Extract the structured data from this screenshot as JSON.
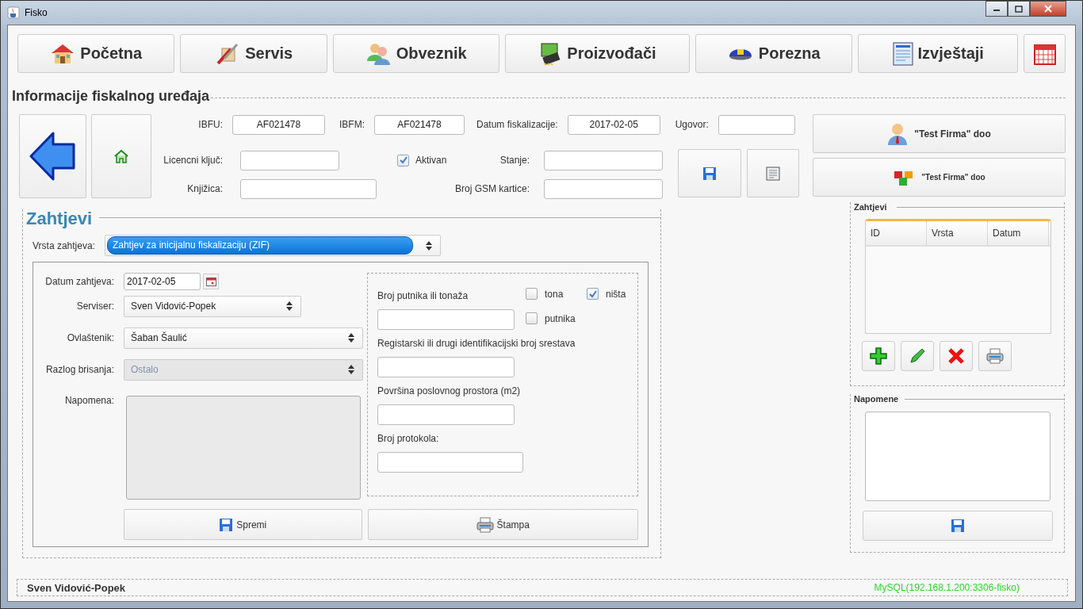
{
  "window": {
    "title": "Fisko"
  },
  "nav": [
    {
      "label": "Početna",
      "kind": "house"
    },
    {
      "label": "Servis",
      "kind": "tools"
    },
    {
      "label": "Obveznik",
      "kind": "users"
    },
    {
      "label": "Proizvođači",
      "kind": "chip"
    },
    {
      "label": "Porezna",
      "kind": "cap"
    },
    {
      "label": "Izvještaji",
      "kind": "report"
    },
    {
      "kind": "calendar"
    }
  ],
  "device_info": {
    "title": "Informacije fiskalnog uređaja",
    "ibfu": {
      "label": "IBFU:",
      "value": "AF021478"
    },
    "ibfm": {
      "label": "IBFM:",
      "value": "AF021478"
    },
    "datum_fiskalizacije": {
      "label": "Datum fiskalizacije:",
      "value": "2017-02-05"
    },
    "ugovor": {
      "label": "Ugovor:"
    },
    "licencni_kljuc": {
      "label": "Licencni ključ:"
    },
    "aktivan": {
      "label": "Aktivan",
      "checked": true
    },
    "stanje": {
      "label": "Stanje:"
    },
    "knjizica": {
      "label": "Knjižica:"
    },
    "broj_gsm_kartice": {
      "label": "Broj GSM kartice:"
    },
    "firm_buttons": [
      {
        "label": "\"Test Firma\" doo",
        "kind": "person"
      },
      {
        "label": "\"Test Firma\" doo",
        "kind": "cubes"
      }
    ]
  },
  "requests": {
    "title": "Zahtjevi",
    "vrsta": {
      "label": "Vrsta zahtjeva:",
      "value": "Zahtjev za inicijalnu fiskalizaciju (ZIF)",
      "focused": true
    },
    "datum": {
      "label": "Datum zahtjeva:",
      "value": "2017-02-05"
    },
    "serviser": {
      "label": "Serviser:",
      "value": "Sven Vidović-Popek"
    },
    "ovlastenik": {
      "label": "Ovlaštenik:",
      "value": "Šaban Šaulić"
    },
    "razlog": {
      "label": "Razlog brisanja:",
      "value": "Ostalo",
      "disabled": true
    },
    "napomena": {
      "label": "Napomena:",
      "disabled": true
    },
    "capacity": {
      "label": "Broj putnika ili tonaža",
      "options": [
        {
          "label": "tona",
          "checked": false
        },
        {
          "label": "ništa",
          "checked": true
        },
        {
          "label": "putnika",
          "checked": false
        }
      ]
    },
    "registration": {
      "label": "Registarski ili drugi identifikacijski broj srestava"
    },
    "area": {
      "label": "Površina poslovnog prostora (m2)"
    },
    "protocol": {
      "label": "Broj protokola:"
    },
    "buttons": [
      {
        "label": "Spremi",
        "kind": "save"
      },
      {
        "label": "Štampa",
        "kind": "print"
      }
    ]
  },
  "side": {
    "requests": {
      "title": "Zahtjevi",
      "columns": [
        "ID",
        "Vrsta",
        "Datum"
      ],
      "actions": [
        {
          "kind": "add"
        },
        {
          "kind": "edit"
        },
        {
          "kind": "delete"
        },
        {
          "kind": "print"
        }
      ]
    },
    "notes": {
      "title": "Napomene"
    }
  },
  "status_bar": {
    "user": "Sven Vidović-Popek",
    "connection": "MySQL(192.168.1.200:3306-fisko)"
  }
}
